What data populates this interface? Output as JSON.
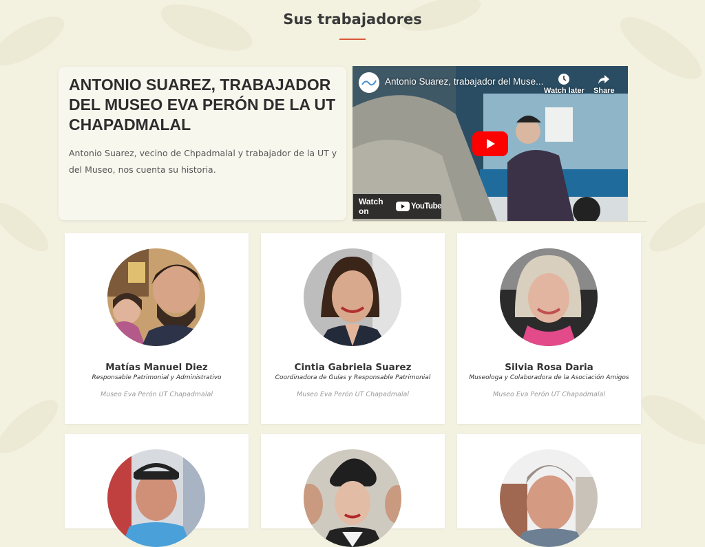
{
  "section": {
    "title": "Sus trabajadores"
  },
  "feature": {
    "title": "ANTONIO SUAREZ, TRABAJADOR DEL MUSEO EVA PERÓN DE LA UT CHAPADMALAL",
    "description": "Antonio Suarez, vecino de Chpadmalal y trabajador de la UT y del Museo, nos cuenta su historia."
  },
  "video": {
    "title": "Antonio Suarez, trabajador del Muse...",
    "watch_later": "Watch later",
    "share": "Share",
    "watch_on": "Watch on",
    "platform": "YouTube"
  },
  "workers": [
    {
      "name": "Matías Manuel Diez",
      "role": "Responsable Patrimonial y Administrativo",
      "org": "Museo Eva Perón UT Chapadmalal"
    },
    {
      "name": "Cintia Gabriela Suarez",
      "role": "Coordinadora de Guías y Responsable Patrimonial",
      "org": "Museo Eva Perón UT Chapadmalal"
    },
    {
      "name": "Silvia Rosa Daria",
      "role": "Museologa y Colaboradora de la Asociación Amigos",
      "org": "Museo Eva Perón UT Chapadmalal"
    },
    {
      "name": "",
      "role": "",
      "org": ""
    },
    {
      "name": "",
      "role": "",
      "org": ""
    },
    {
      "name": "",
      "role": "",
      "org": ""
    }
  ],
  "colors": {
    "accent": "#d9573a",
    "background": "#f3f1e0",
    "youtube_red": "#ff0000"
  }
}
